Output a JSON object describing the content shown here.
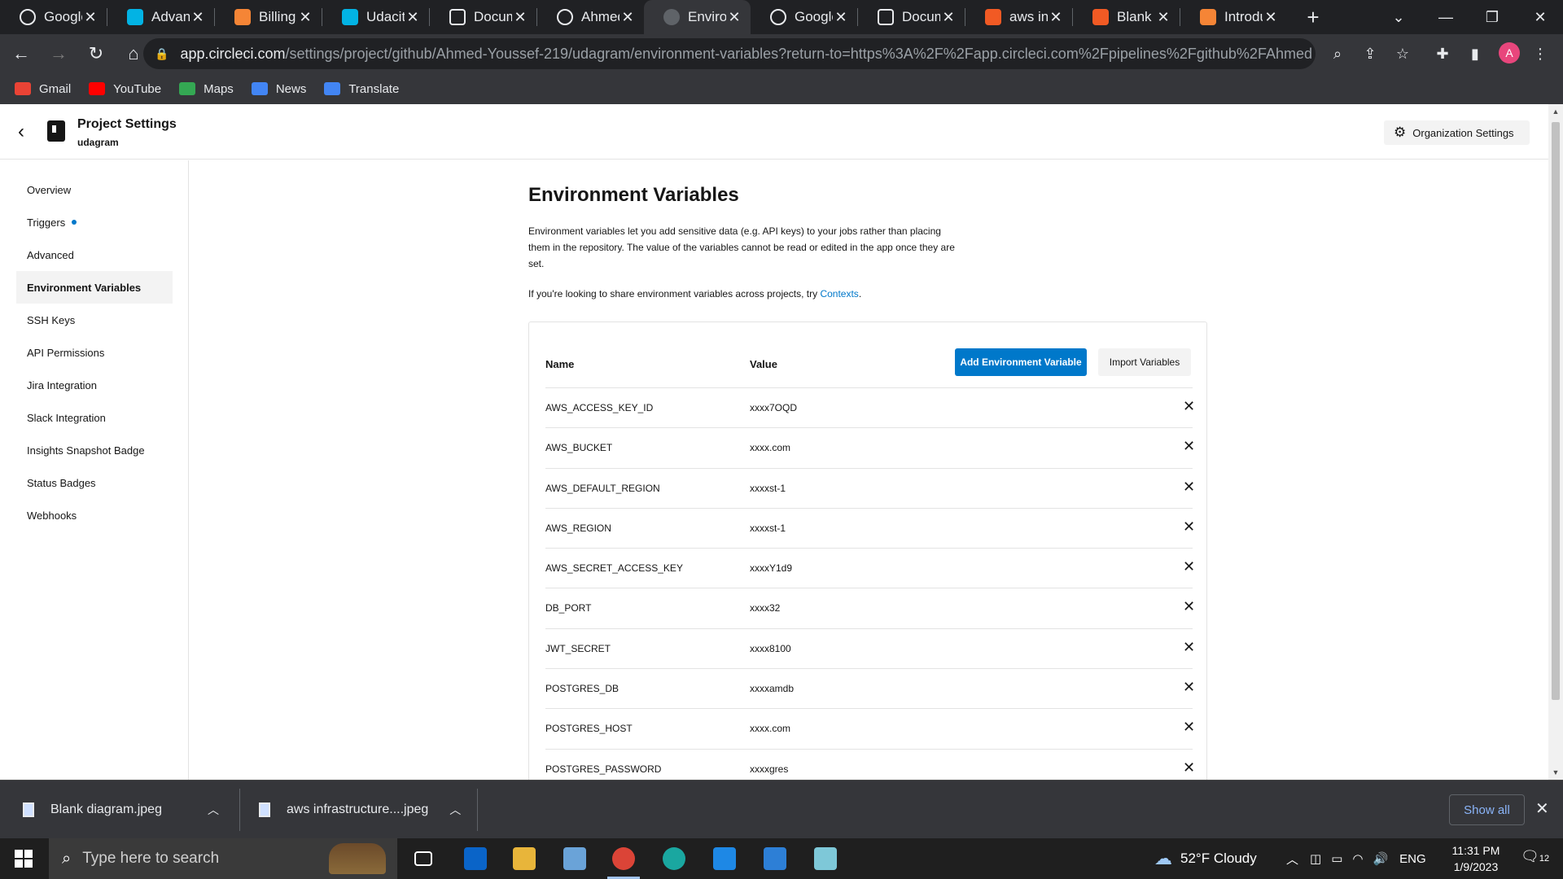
{
  "browser": {
    "tabs": [
      {
        "title": "Google",
        "icon": "google-icon",
        "color": "#ffffff"
      },
      {
        "title": "Advanc",
        "icon": "udacity-icon",
        "color": "#02b3e4"
      },
      {
        "title": "Billing M",
        "icon": "aws-icon",
        "color": "#f58536"
      },
      {
        "title": "Udacity",
        "icon": "udacity-icon",
        "color": "#02b3e4"
      },
      {
        "title": "Docum",
        "icon": "docs-icon",
        "color": "#ffffff"
      },
      {
        "title": "Ahmed",
        "icon": "github-icon",
        "color": "#ffffff"
      },
      {
        "title": "Environ",
        "icon": "circleci-icon",
        "color": "#5f6368",
        "active": true
      },
      {
        "title": "Google",
        "icon": "google-icon",
        "color": "#ffffff"
      },
      {
        "title": "Docum",
        "icon": "docs-icon",
        "color": "#ffffff"
      },
      {
        "title": "aws infr",
        "icon": "lucid-icon",
        "color": "#f15a24"
      },
      {
        "title": "Blank d",
        "icon": "lucid-icon",
        "color": "#f15a24"
      },
      {
        "title": "Introdu",
        "icon": "aws-icon",
        "color": "#f58536"
      }
    ],
    "url_host": "app.circleci.com",
    "url_path": "/settings/project/github/Ahmed-Youssef-219/udagram/environment-variables?return-to=https%3A%2F%2Fapp.circleci.com%2Fpipelines%2Fgithub%2FAhmed-You...",
    "profile_initial": "A",
    "profile_color": "#e8467c",
    "bookmarks": [
      {
        "label": "Gmail",
        "icon": "gmail-icon",
        "color": "#ea4335"
      },
      {
        "label": "YouTube",
        "icon": "youtube-icon",
        "color": "#ff0000"
      },
      {
        "label": "Maps",
        "icon": "maps-icon",
        "color": "#34a853"
      },
      {
        "label": "News",
        "icon": "news-icon",
        "color": "#4285f4"
      },
      {
        "label": "Translate",
        "icon": "translate-icon",
        "color": "#4285f4"
      }
    ]
  },
  "header": {
    "title": "Project Settings",
    "project": "udagram",
    "org_settings_label": "Organization Settings"
  },
  "sidebar": {
    "items": [
      {
        "label": "Overview"
      },
      {
        "label": "Triggers",
        "dot": true
      },
      {
        "label": "Advanced"
      },
      {
        "label": "Environment Variables",
        "active": true
      },
      {
        "label": "SSH Keys"
      },
      {
        "label": "API Permissions"
      },
      {
        "label": "Jira Integration"
      },
      {
        "label": "Slack Integration"
      },
      {
        "label": "Insights Snapshot Badge"
      },
      {
        "label": "Status Badges"
      },
      {
        "label": "Webhooks"
      }
    ]
  },
  "main": {
    "title": "Environment Variables",
    "description": "Environment variables let you add sensitive data (e.g. API keys) to your jobs rather than placing them in the repository. The value of the variables cannot be read or edited in the app once they are set.",
    "share_text": "If you're looking to share environment variables across projects, try ",
    "share_link": "Contexts",
    "share_end": ".",
    "table": {
      "name_header": "Name",
      "value_header": "Value",
      "add_button": "Add Environment Variable",
      "import_button": "Import Variables",
      "rows": [
        {
          "name": "AWS_ACCESS_KEY_ID",
          "value": "xxxx7OQD"
        },
        {
          "name": "AWS_BUCKET",
          "value": "xxxx.com"
        },
        {
          "name": "AWS_DEFAULT_REGION",
          "value": "xxxxst-1"
        },
        {
          "name": "AWS_REGION",
          "value": "xxxxst-1"
        },
        {
          "name": "AWS_SECRET_ACCESS_KEY",
          "value": "xxxxY1d9"
        },
        {
          "name": "DB_PORT",
          "value": "xxxx32"
        },
        {
          "name": "JWT_SECRET",
          "value": "xxxx8100"
        },
        {
          "name": "POSTGRES_DB",
          "value": "xxxxamdb"
        },
        {
          "name": "POSTGRES_HOST",
          "value": "xxxx.com"
        },
        {
          "name": "POSTGRES_PASSWORD",
          "value": "xxxxgres"
        }
      ]
    }
  },
  "downloads": {
    "items": [
      {
        "name": "Blank diagram.jpeg"
      },
      {
        "name": "aws infrastructure....jpeg"
      }
    ],
    "show_all": "Show all"
  },
  "taskbar": {
    "search_placeholder": "Type here to search",
    "weather": "52°F  Cloudy",
    "language": "ENG",
    "time": "11:31 PM",
    "date": "1/9/2023",
    "notifications": "12",
    "apps": [
      {
        "icon": "task-view-icon",
        "color": "#1f1f1f"
      },
      {
        "icon": "mail-icon",
        "color": "#0a64c8"
      },
      {
        "icon": "file-explorer-icon",
        "color": "#e8b53a"
      },
      {
        "icon": "paint-icon",
        "color": "#6aa3d8"
      },
      {
        "icon": "chrome-icon",
        "color": "#db4437",
        "open": true
      },
      {
        "icon": "edge-icon",
        "color": "#1aa7a0"
      },
      {
        "icon": "vscode-icon",
        "color": "#1e88e5"
      },
      {
        "icon": "photos-icon",
        "color": "#2d7fd6"
      },
      {
        "icon": "notepad-icon",
        "color": "#7ec8d8"
      }
    ]
  }
}
